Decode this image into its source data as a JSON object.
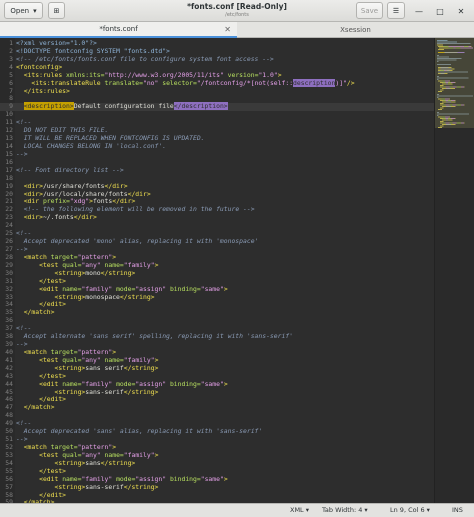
{
  "header": {
    "open_label": "Open",
    "open_arrow": "▾",
    "new_tab_icon": "⊞",
    "title": "*fonts.conf [Read-Only]",
    "subtitle": "/etc/fonts",
    "save_label": "Save",
    "menu_icon": "☰",
    "minimize_icon": "—",
    "maximize_icon": "□",
    "close_icon": "✕"
  },
  "tabs": [
    {
      "label": "*fonts.conf",
      "close": "✕",
      "active": true
    },
    {
      "label": "Xsession",
      "active": false
    }
  ],
  "status": {
    "language": "XML",
    "tab_width": "Tab Width: 4",
    "position": "Ln 9, Col 6",
    "mode": "INS",
    "dropdown": "▾"
  },
  "code_lines": [
    {
      "n": "1",
      "segs": [
        [
          "pi",
          "<?xml version=\"1.0\"?>"
        ]
      ]
    },
    {
      "n": "2",
      "segs": [
        [
          "pi",
          "<!DOCTYPE fontconfig SYSTEM \"fonts.dtd\">"
        ]
      ]
    },
    {
      "n": "3",
      "segs": [
        [
          "com",
          "<!-- /etc/fonts/fonts.conf file to configure system font access -->"
        ]
      ]
    },
    {
      "n": "4",
      "segs": [
        [
          "tag",
          "<fontconfig>"
        ]
      ]
    },
    {
      "n": "5",
      "segs": [
        [
          "txt",
          "  "
        ],
        [
          "tag",
          "<its:rules "
        ],
        [
          "attr",
          "xmlns:its="
        ],
        [
          "str",
          "\"http://www.w3.org/2005/11/its\""
        ],
        [
          "attr",
          " version="
        ],
        [
          "str",
          "\"1.0\""
        ],
        [
          "tag",
          ">"
        ]
      ]
    },
    {
      "n": "6",
      "segs": [
        [
          "txt",
          "    "
        ],
        [
          "tag",
          "<its:translateRule "
        ],
        [
          "attr",
          "translate="
        ],
        [
          "str",
          "\"no\""
        ],
        [
          "attr",
          " selector="
        ],
        [
          "str",
          "\"/fontconfig/*[not(self::"
        ],
        [
          "hl2",
          "description"
        ],
        [
          "str",
          ")]\""
        ],
        [
          "tag",
          "/>"
        ]
      ]
    },
    {
      "n": "7",
      "segs": [
        [
          "txt",
          "  "
        ],
        [
          "tag",
          "</its:rules>"
        ]
      ]
    },
    {
      "n": "8",
      "segs": []
    },
    {
      "n": "9",
      "cur": true,
      "segs": [
        [
          "txt",
          "  "
        ],
        [
          "hl",
          "<description>"
        ],
        [
          "txt",
          "Default configuration file"
        ],
        [
          "hl2",
          "</description>"
        ]
      ]
    },
    {
      "n": "10",
      "segs": []
    },
    {
      "n": "11",
      "segs": [
        [
          "com",
          "<!--"
        ]
      ]
    },
    {
      "n": "12",
      "segs": [
        [
          "com",
          "  DO NOT EDIT THIS FILE."
        ]
      ]
    },
    {
      "n": "13",
      "segs": [
        [
          "com",
          "  IT WILL BE REPLACED WHEN FONTCONFIG IS UPDATED."
        ]
      ]
    },
    {
      "n": "14",
      "segs": [
        [
          "com",
          "  LOCAL CHANGES BELONG IN 'local.conf'."
        ]
      ]
    },
    {
      "n": "15",
      "segs": [
        [
          "com",
          "-->"
        ]
      ]
    },
    {
      "n": "16",
      "segs": []
    },
    {
      "n": "17",
      "segs": [
        [
          "com",
          "<!-- Font directory list -->"
        ]
      ]
    },
    {
      "n": "18",
      "segs": []
    },
    {
      "n": "19",
      "segs": [
        [
          "txt",
          "  "
        ],
        [
          "tag",
          "<dir>"
        ],
        [
          "txt",
          "/usr/share/fonts"
        ],
        [
          "tag",
          "</dir>"
        ]
      ]
    },
    {
      "n": "20",
      "segs": [
        [
          "txt",
          "  "
        ],
        [
          "tag",
          "<dir>"
        ],
        [
          "txt",
          "/usr/local/share/fonts"
        ],
        [
          "tag",
          "</dir>"
        ]
      ]
    },
    {
      "n": "21",
      "segs": [
        [
          "txt",
          "  "
        ],
        [
          "tag",
          "<dir "
        ],
        [
          "attr",
          "prefix="
        ],
        [
          "str",
          "\"xdg\""
        ],
        [
          "tag",
          ">"
        ],
        [
          "txt",
          "fonts"
        ],
        [
          "tag",
          "</dir>"
        ]
      ]
    },
    {
      "n": "22",
      "segs": [
        [
          "txt",
          "  "
        ],
        [
          "com",
          "<!-- the following element will be removed in the future -->"
        ]
      ]
    },
    {
      "n": "23",
      "segs": [
        [
          "txt",
          "  "
        ],
        [
          "tag",
          "<dir>"
        ],
        [
          "txt",
          "~/.fonts"
        ],
        [
          "tag",
          "</dir>"
        ]
      ]
    },
    {
      "n": "24",
      "segs": []
    },
    {
      "n": "25",
      "segs": [
        [
          "com",
          "<!--"
        ]
      ]
    },
    {
      "n": "26",
      "segs": [
        [
          "com",
          "  Accept deprecated 'mono' alias, replacing it with 'monospace'"
        ]
      ]
    },
    {
      "n": "27",
      "segs": [
        [
          "com",
          "-->"
        ]
      ]
    },
    {
      "n": "28",
      "segs": [
        [
          "txt",
          "  "
        ],
        [
          "tag",
          "<match "
        ],
        [
          "attr",
          "target="
        ],
        [
          "str",
          "\"pattern\""
        ],
        [
          "tag",
          ">"
        ]
      ]
    },
    {
      "n": "29",
      "segs": [
        [
          "txt",
          "      "
        ],
        [
          "tag",
          "<test "
        ],
        [
          "attr",
          "qual="
        ],
        [
          "str",
          "\"any\""
        ],
        [
          "attr",
          " name="
        ],
        [
          "str",
          "\"family\""
        ],
        [
          "tag",
          ">"
        ]
      ]
    },
    {
      "n": "30",
      "segs": [
        [
          "txt",
          "          "
        ],
        [
          "tag",
          "<string>"
        ],
        [
          "txt",
          "mono"
        ],
        [
          "tag",
          "</string>"
        ]
      ]
    },
    {
      "n": "31",
      "segs": [
        [
          "txt",
          "      "
        ],
        [
          "tag",
          "</test>"
        ]
      ]
    },
    {
      "n": "32",
      "segs": [
        [
          "txt",
          "      "
        ],
        [
          "tag",
          "<edit "
        ],
        [
          "attr",
          "name="
        ],
        [
          "str",
          "\"family\""
        ],
        [
          "attr",
          " mode="
        ],
        [
          "str",
          "\"assign\""
        ],
        [
          "attr",
          " binding="
        ],
        [
          "str",
          "\"same\""
        ],
        [
          "tag",
          ">"
        ]
      ]
    },
    {
      "n": "33",
      "segs": [
        [
          "txt",
          "          "
        ],
        [
          "tag",
          "<string>"
        ],
        [
          "txt",
          "monospace"
        ],
        [
          "tag",
          "</string>"
        ]
      ]
    },
    {
      "n": "34",
      "segs": [
        [
          "txt",
          "      "
        ],
        [
          "tag",
          "</edit>"
        ]
      ]
    },
    {
      "n": "35",
      "segs": [
        [
          "txt",
          "  "
        ],
        [
          "tag",
          "</match>"
        ]
      ]
    },
    {
      "n": "36",
      "segs": []
    },
    {
      "n": "37",
      "segs": [
        [
          "com",
          "<!--"
        ]
      ]
    },
    {
      "n": "38",
      "segs": [
        [
          "com",
          "  Accept alternate 'sans serif' spelling, replacing it with 'sans-serif'"
        ]
      ]
    },
    {
      "n": "39",
      "segs": [
        [
          "com",
          "-->"
        ]
      ]
    },
    {
      "n": "40",
      "segs": [
        [
          "txt",
          "  "
        ],
        [
          "tag",
          "<match "
        ],
        [
          "attr",
          "target="
        ],
        [
          "str",
          "\"pattern\""
        ],
        [
          "tag",
          ">"
        ]
      ]
    },
    {
      "n": "41",
      "segs": [
        [
          "txt",
          "      "
        ],
        [
          "tag",
          "<test "
        ],
        [
          "attr",
          "qual="
        ],
        [
          "str",
          "\"any\""
        ],
        [
          "attr",
          " name="
        ],
        [
          "str",
          "\"family\""
        ],
        [
          "tag",
          ">"
        ]
      ]
    },
    {
      "n": "42",
      "segs": [
        [
          "txt",
          "          "
        ],
        [
          "tag",
          "<string>"
        ],
        [
          "txt",
          "sans serif"
        ],
        [
          "tag",
          "</string>"
        ]
      ]
    },
    {
      "n": "43",
      "segs": [
        [
          "txt",
          "      "
        ],
        [
          "tag",
          "</test>"
        ]
      ]
    },
    {
      "n": "44",
      "segs": [
        [
          "txt",
          "      "
        ],
        [
          "tag",
          "<edit "
        ],
        [
          "attr",
          "name="
        ],
        [
          "str",
          "\"family\""
        ],
        [
          "attr",
          " mode="
        ],
        [
          "str",
          "\"assign\""
        ],
        [
          "attr",
          " binding="
        ],
        [
          "str",
          "\"same\""
        ],
        [
          "tag",
          ">"
        ]
      ]
    },
    {
      "n": "45",
      "segs": [
        [
          "txt",
          "          "
        ],
        [
          "tag",
          "<string>"
        ],
        [
          "txt",
          "sans-serif"
        ],
        [
          "tag",
          "</string>"
        ]
      ]
    },
    {
      "n": "46",
      "segs": [
        [
          "txt",
          "      "
        ],
        [
          "tag",
          "</edit>"
        ]
      ]
    },
    {
      "n": "47",
      "segs": [
        [
          "txt",
          "  "
        ],
        [
          "tag",
          "</match>"
        ]
      ]
    },
    {
      "n": "48",
      "segs": []
    },
    {
      "n": "49",
      "segs": [
        [
          "com",
          "<!--"
        ]
      ]
    },
    {
      "n": "50",
      "segs": [
        [
          "com",
          "  Accept deprecated 'sans' alias, replacing it with 'sans-serif'"
        ]
      ]
    },
    {
      "n": "51",
      "segs": [
        [
          "com",
          "-->"
        ]
      ]
    },
    {
      "n": "52",
      "segs": [
        [
          "txt",
          "  "
        ],
        [
          "tag",
          "<match "
        ],
        [
          "attr",
          "target="
        ],
        [
          "str",
          "\"pattern\""
        ],
        [
          "tag",
          ">"
        ]
      ]
    },
    {
      "n": "53",
      "segs": [
        [
          "txt",
          "      "
        ],
        [
          "tag",
          "<test "
        ],
        [
          "attr",
          "qual="
        ],
        [
          "str",
          "\"any\""
        ],
        [
          "attr",
          " name="
        ],
        [
          "str",
          "\"family\""
        ],
        [
          "tag",
          ">"
        ]
      ]
    },
    {
      "n": "54",
      "segs": [
        [
          "txt",
          "          "
        ],
        [
          "tag",
          "<string>"
        ],
        [
          "txt",
          "sans"
        ],
        [
          "tag",
          "</string>"
        ]
      ]
    },
    {
      "n": "55",
      "segs": [
        [
          "txt",
          "      "
        ],
        [
          "tag",
          "</test>"
        ]
      ]
    },
    {
      "n": "56",
      "segs": [
        [
          "txt",
          "      "
        ],
        [
          "tag",
          "<edit "
        ],
        [
          "attr",
          "name="
        ],
        [
          "str",
          "\"family\""
        ],
        [
          "attr",
          " mode="
        ],
        [
          "str",
          "\"assign\""
        ],
        [
          "attr",
          " binding="
        ],
        [
          "str",
          "\"same\""
        ],
        [
          "tag",
          ">"
        ]
      ]
    },
    {
      "n": "57",
      "segs": [
        [
          "txt",
          "          "
        ],
        [
          "tag",
          "<string>"
        ],
        [
          "txt",
          "sans-serif"
        ],
        [
          "tag",
          "</string>"
        ]
      ]
    },
    {
      "n": "58",
      "segs": [
        [
          "txt",
          "      "
        ],
        [
          "tag",
          "</edit>"
        ]
      ]
    },
    {
      "n": "59",
      "segs": [
        [
          "txt",
          "  "
        ],
        [
          "tag",
          "</match>"
        ]
      ]
    }
  ]
}
